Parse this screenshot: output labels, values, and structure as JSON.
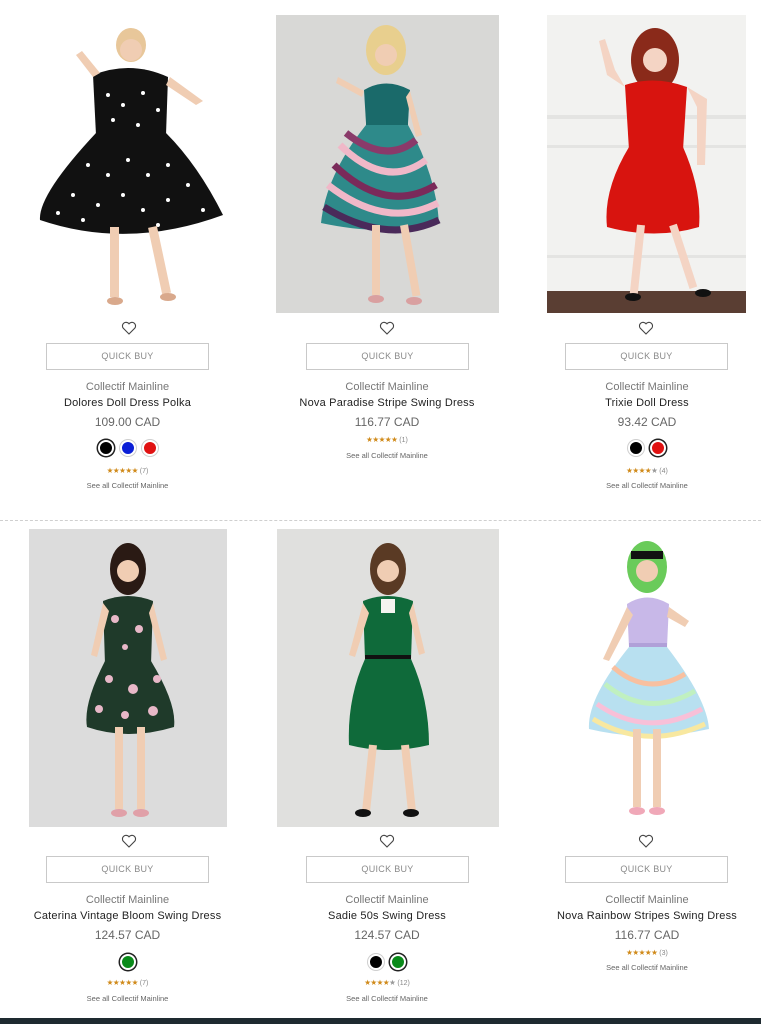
{
  "quick_buy_label": "QUICK BUY",
  "products": [
    {
      "brand": "Collectif Mainline",
      "name": "Dolores Doll Dress Polka",
      "price": "109.00 CAD",
      "swatches": [
        {
          "color": "#000000",
          "selected": true
        },
        {
          "color": "#0b1fd6",
          "selected": false
        },
        {
          "color": "#e01212",
          "selected": false
        }
      ],
      "rating": 5,
      "review_count": "(7)",
      "see_all": "See all Collectif Mainline"
    },
    {
      "brand": "Collectif Mainline",
      "name": "Nova Paradise Stripe Swing Dress",
      "price": "116.77 CAD",
      "swatches": [],
      "rating": 5,
      "review_count": "(1)",
      "see_all": "See all Collectif Mainline"
    },
    {
      "brand": "Collectif Mainline",
      "name": "Trixie Doll Dress",
      "price": "93.42 CAD",
      "swatches": [
        {
          "color": "#000000",
          "selected": false
        },
        {
          "color": "#e01212",
          "selected": true
        }
      ],
      "rating": 4,
      "review_count": "(4)",
      "see_all": "See all Collectif Mainline"
    },
    {
      "brand": "Collectif Mainline",
      "name": "Caterina Vintage Bloom Swing Dress",
      "price": "124.57 CAD",
      "swatches": [
        {
          "color": "#0a8a1a",
          "selected": true
        }
      ],
      "rating": 5,
      "review_count": "(7)",
      "see_all": "See all Collectif Mainline"
    },
    {
      "brand": "Collectif Mainline",
      "name": "Sadie 50s Swing Dress",
      "price": "124.57 CAD",
      "swatches": [
        {
          "color": "#000000",
          "selected": false
        },
        {
          "color": "#0a8a1a",
          "selected": true
        }
      ],
      "rating": 4,
      "review_count": "(12)",
      "see_all": "See all Collectif Mainline"
    },
    {
      "brand": "Collectif Mainline",
      "name": "Nova Rainbow Stripes Swing Dress",
      "price": "116.77 CAD",
      "swatches": [],
      "rating": 5,
      "review_count": "(3)",
      "see_all": "See all Collectif Mainline"
    }
  ],
  "colors": {
    "star": "#d08a1a",
    "footer": "#1e2a30"
  }
}
